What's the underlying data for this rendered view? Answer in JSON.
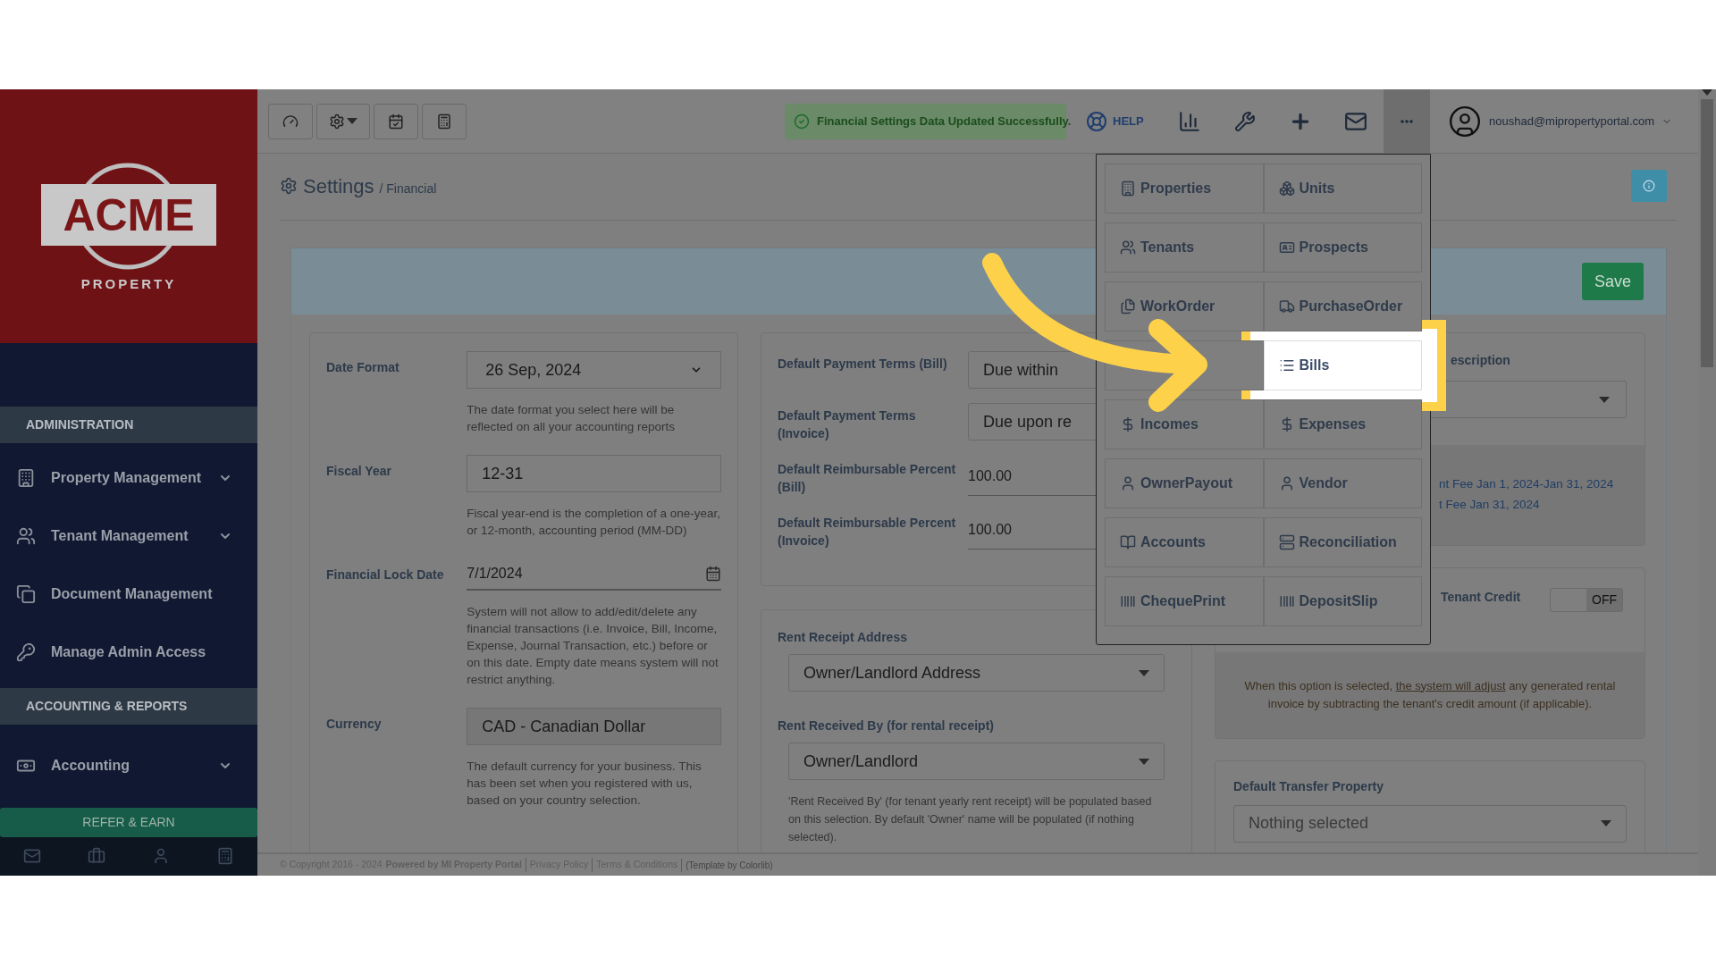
{
  "logo": {
    "wordmark": "ACME",
    "tagline": "PROPERTY"
  },
  "sidebar": {
    "sections": [
      {
        "title": "ADMINISTRATION",
        "items": [
          {
            "label": "Property Management",
            "expandable": true
          },
          {
            "label": "Tenant Management",
            "expandable": true
          },
          {
            "label": "Document Management",
            "expandable": false
          },
          {
            "label": "Manage Admin Access",
            "expandable": false
          }
        ]
      },
      {
        "title": "ACCOUNTING & REPORTS",
        "items": [
          {
            "label": "Accounting",
            "expandable": true
          }
        ]
      }
    ],
    "refer_button": "REFER & EARN"
  },
  "topbar": {
    "notification": "Financial Settings Data Updated Successfully.",
    "help": "HELP",
    "user_email": "noushad@mipropertyportal.com",
    "more_open": true
  },
  "page": {
    "title": "Settings",
    "breadcrumb": "/ Financial",
    "save": "Save"
  },
  "left_card": {
    "fields": [
      {
        "kind": "select",
        "label": "Date Format",
        "value": "26 Sep, 2024",
        "hint": "The date format you select here will be reflected on all your accounting reports"
      },
      {
        "kind": "input",
        "label": "Fiscal Year",
        "value": "12-31",
        "hint": "Fiscal year-end is the completion of a one-year, or 12-month, accounting period (MM-DD)"
      },
      {
        "kind": "date",
        "label": "Financial Lock Date",
        "value": "7/1/2024",
        "hint": "System will not allow to add/edit/delete any financial transactions (i.e. Invoice, Bill, Income, Expense, Journal Transaction, etc.) before or on this date. Empty date means system will not restrict anything."
      },
      {
        "kind": "readonly",
        "label": "Currency",
        "value": "CAD - Canadian Dollar",
        "hint": "The default currency for your business. This has been set when you registered with us, based on your country selection."
      }
    ]
  },
  "middle_card": {
    "terms": [
      {
        "kind": "select",
        "label": "Default Payment Terms (Bill)",
        "value": "Due within"
      },
      {
        "kind": "select",
        "label": "Default Payment Terms (Invoice)",
        "value": "Due upon re"
      },
      {
        "kind": "number",
        "label": "Default Reimbursable Percent (Bill)",
        "value": "100.00"
      },
      {
        "kind": "number",
        "label": "Default Reimbursable Percent (Invoice)",
        "value": "100.00"
      }
    ],
    "receipt": [
      {
        "label": "Rent Receipt Address",
        "value": "Owner/Landlord Address"
      },
      {
        "label": "Rent Received By (for rental receipt)",
        "value": "Owner/Landlord",
        "hint": "'Rent Received By' (for tenant yearly rent receipt) will be populated based on this selection. By default 'Owner' name will be populated (if nothing selected)."
      }
    ]
  },
  "right_card": {
    "description_label": "escription",
    "fee_lines": [
      "nt Fee Jan 1, 2024-Jan 31, 2024",
      "t Fee Jan 31, 2024"
    ],
    "tenant_credit": {
      "label": "Tenant Credit",
      "on": false,
      "state_text": "OFF",
      "note_before": "When this option is selected, ",
      "note_link": "the system will adjust",
      "note_after": " any generated rental invoice by subtracting the tenant's credit amount (if applicable)."
    },
    "transfer": {
      "label": "Default Transfer Property",
      "placeholder": "Nothing selected"
    }
  },
  "quick_menu": {
    "items": [
      {
        "label": "Properties",
        "selected": false
      },
      {
        "label": "Units",
        "selected": false
      },
      {
        "label": "Tenants",
        "selected": false
      },
      {
        "label": "Prospects",
        "selected": false
      },
      {
        "label": "WorkOrder",
        "selected": false
      },
      {
        "label": "PurchaseOrder",
        "selected": false
      },
      {
        "selected": false
      },
      {
        "label": "Bills",
        "selected": true
      },
      {
        "label": "Incomes",
        "selected": false
      },
      {
        "label": "Expenses",
        "selected": false
      },
      {
        "label": "OwnerPayout",
        "selected": false
      },
      {
        "label": "Vendor",
        "selected": false
      },
      {
        "label": "Accounts",
        "selected": false
      },
      {
        "label": "Reconciliation",
        "selected": false
      },
      {
        "label": "ChequePrint",
        "selected": false
      },
      {
        "label": "DepositSlip",
        "selected": false
      }
    ]
  },
  "footer": {
    "copyright": "© Copyright 2016 - 2024",
    "powered": "Powered by MI Property Portal",
    "links": [
      "Privacy Policy",
      "Terms & Conditions"
    ],
    "credit": "(Template by Colorlib)"
  }
}
